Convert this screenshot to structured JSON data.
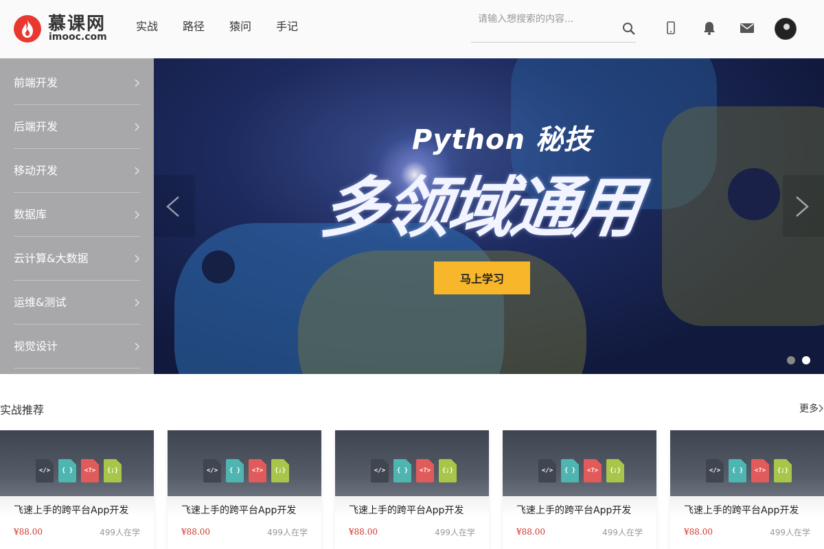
{
  "header": {
    "logo_text": "慕课网",
    "logo_sub": "imooc.com",
    "nav": [
      "实战",
      "路径",
      "猿问",
      "手记"
    ],
    "search_placeholder": "请输入想搜索的内容..."
  },
  "sidebar": {
    "items": [
      "前端开发",
      "后端开发",
      "移动开发",
      "数据库",
      "云计算&大数据",
      "运维&测试",
      "视觉设计"
    ]
  },
  "banner": {
    "kicker": "Python 秘技",
    "headline": "多领域通用",
    "cta": "马上学习",
    "slide_count": 2,
    "active_slide": 2
  },
  "section": {
    "title": "实战推荐",
    "more": "更多"
  },
  "cards": [
    {
      "title": "飞速上手的跨平台App开发",
      "price": "¥88.00",
      "students": "499人在学"
    },
    {
      "title": "飞速上手的跨平台App开发",
      "price": "¥88.00",
      "students": "499人在学"
    },
    {
      "title": "飞速上手的跨平台App开发",
      "price": "¥88.00",
      "students": "499人在学"
    },
    {
      "title": "飞速上手的跨平台App开发",
      "price": "¥88.00",
      "students": "499人在学"
    },
    {
      "title": "飞速上手的跨平台App开发",
      "price": "¥88.00",
      "students": "499人在学"
    }
  ],
  "file_icons": [
    "</>",
    "{ }",
    "<?>",
    "{;}"
  ],
  "colors": {
    "brand": "#e8382f",
    "cta": "#f8b62a",
    "price": "#d0342c",
    "sidebar": "#a8a8ab"
  }
}
